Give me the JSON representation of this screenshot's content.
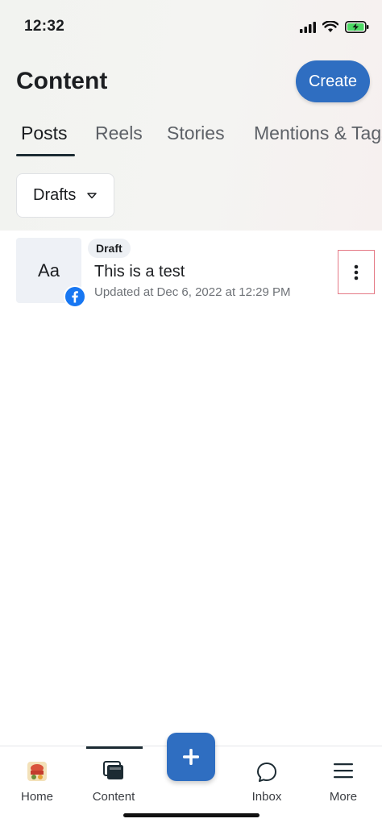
{
  "status_bar": {
    "time": "12:32"
  },
  "header": {
    "title": "Content",
    "create_label": "Create"
  },
  "tabs": [
    {
      "label": "Posts",
      "active": true
    },
    {
      "label": "Reels",
      "active": false
    },
    {
      "label": "Stories",
      "active": false
    },
    {
      "label": "Mentions & Tags",
      "active": false
    }
  ],
  "filter": {
    "selected": "Drafts"
  },
  "posts": [
    {
      "thumbnail_text": "Aa",
      "badge": "Draft",
      "title": "This is a test",
      "meta": "Updated at Dec 6, 2022 at 12:29 PM",
      "platform_icon": "facebook-icon"
    }
  ],
  "bottom_nav": [
    {
      "label": "Home",
      "icon": "home-avatar-icon"
    },
    {
      "label": "Content",
      "icon": "content-icon",
      "active": true
    },
    {
      "label": "",
      "icon": "plus-icon"
    },
    {
      "label": "Inbox",
      "icon": "chat-bubble-icon"
    },
    {
      "label": "More",
      "icon": "menu-icon"
    }
  ],
  "colors": {
    "accent": "#2f6ec1",
    "facebook": "#1877f2"
  }
}
